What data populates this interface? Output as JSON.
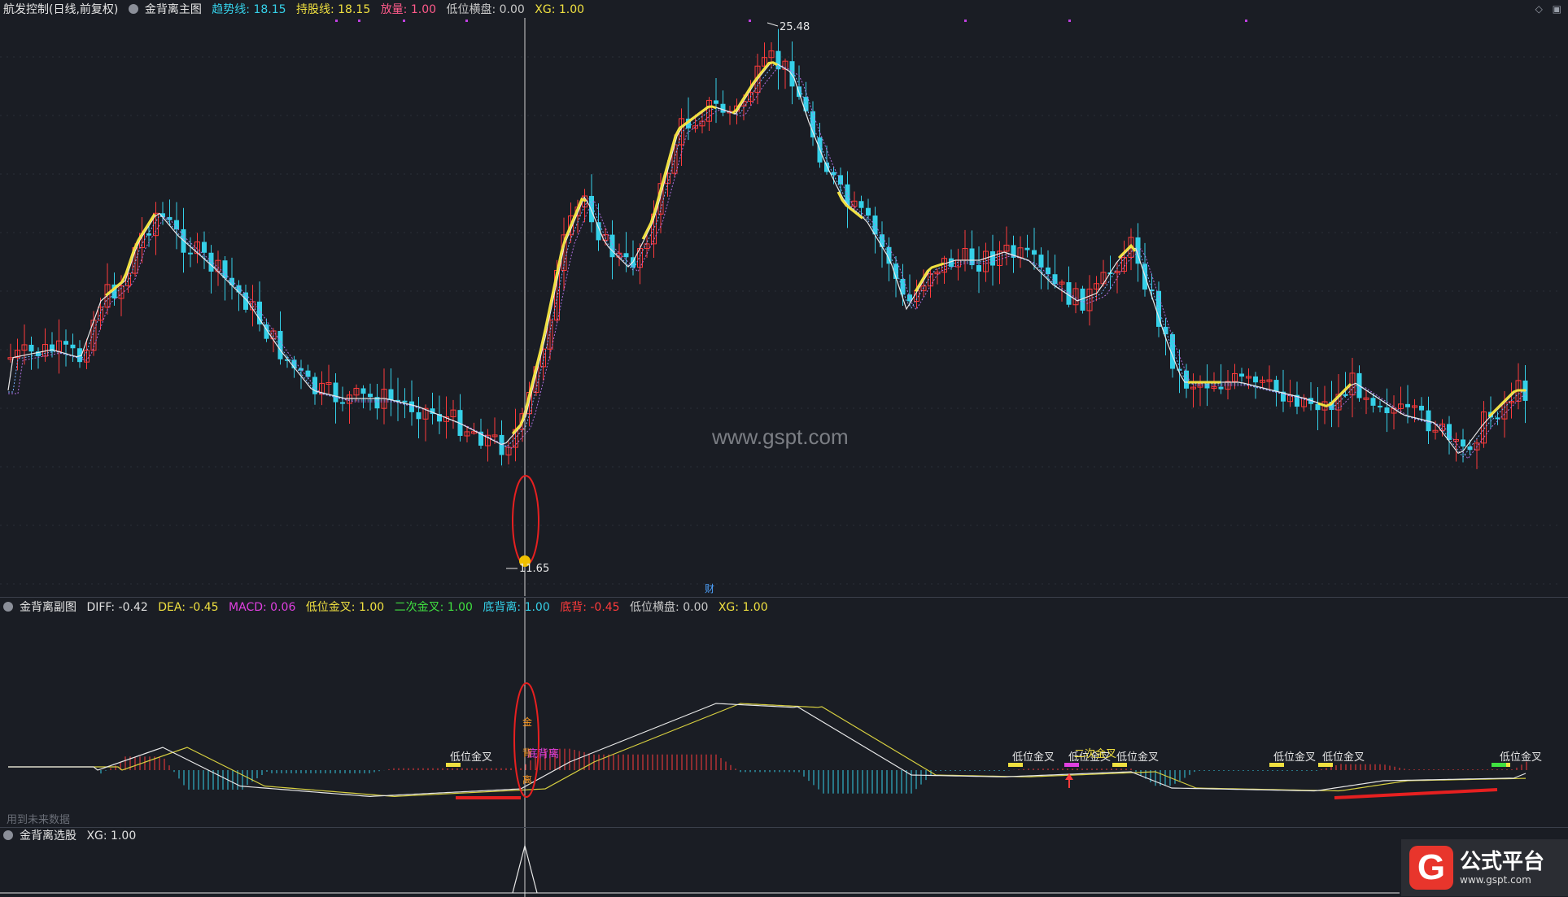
{
  "main": {
    "title": "航发控制(日线,前复权)",
    "indicator_name": "金背离主图",
    "fields": [
      {
        "label": "趋势线: 18.15",
        "color": "#35d0e8"
      },
      {
        "label": "持股线: 18.15",
        "color": "#f0e040"
      },
      {
        "label": "放量: 1.00",
        "color": "#ff5a8a"
      },
      {
        "label": "低位横盘: 0.00",
        "color": "#c8c8c8"
      },
      {
        "label": "XG: 1.00",
        "color": "#f0e040"
      }
    ],
    "high_label": "25.48",
    "low_label": "11.65",
    "watermark": "www.gspt.com",
    "cai_badge": "财"
  },
  "sub": {
    "indicator_name": "金背离副图",
    "fields": [
      {
        "label": "DIFF: -0.42",
        "color": "#e0e0e0"
      },
      {
        "label": "DEA: -0.45",
        "color": "#f0e040"
      },
      {
        "label": "MACD: 0.06",
        "color": "#e040e0"
      },
      {
        "label": "低位金叉: 1.00",
        "color": "#f0e040"
      },
      {
        "label": "二次金叉: 1.00",
        "color": "#40e040"
      },
      {
        "label": "底背离: 1.00",
        "color": "#35d0e8"
      },
      {
        "label": "底背: -0.45",
        "color": "#ff3b3b"
      },
      {
        "label": "低位横盘: 0.00",
        "color": "#c8c8c8"
      },
      {
        "label": "XG: 1.00",
        "color": "#f0e040"
      }
    ],
    "cross_labels": [
      "低位金叉",
      "低位金叉",
      "低位金叉",
      "低位金叉",
      "低位金叉",
      "低位金叉",
      "低位金叉",
      "低位金叉"
    ],
    "cross_label_overlaps": [
      "二次金叉",
      "底背离"
    ],
    "marker_chars": [
      "金",
      "背",
      "离"
    ],
    "future_note": "用到未来数据"
  },
  "pick": {
    "indicator_name": "金背离选股",
    "fields": [
      {
        "label": "XG: 1.00",
        "color": "#e0e0e0"
      }
    ]
  },
  "logo": {
    "mark": "G",
    "name": "公式平台",
    "url": "www.gspt.com"
  },
  "colors": {
    "up": "#ff3b3b",
    "down": "#35d0e8",
    "trend": "#f0e040",
    "ma_white": "#e8e8e8",
    "ma_purple": "#b070e0",
    "background": "#1a1d24",
    "crosshair": "#d0d0d0"
  },
  "chart_data": {
    "type": "candlestick",
    "price_range": [
      11.65,
      25.48
    ],
    "annotations": [
      "25.48",
      "11.65"
    ]
  }
}
